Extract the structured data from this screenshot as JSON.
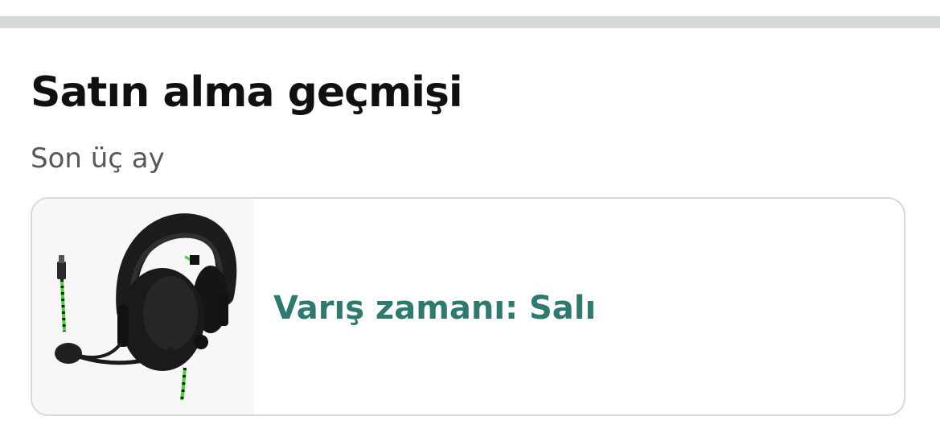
{
  "header": {
    "title": "Satın alma geçmişi",
    "subtitle": "Son üç ay"
  },
  "order": {
    "delivery_status": "Varış zamanı: Salı",
    "image_icon": "headset-product-image",
    "status_color": "#2e7a6f"
  },
  "colors": {
    "divider": "#d5d9d9",
    "title": "#0f1111",
    "subtitle": "#565959",
    "accent_cable": "#44d62c"
  }
}
